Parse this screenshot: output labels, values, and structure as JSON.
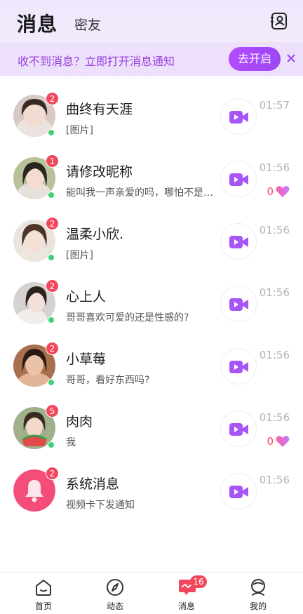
{
  "header": {
    "title": "消息",
    "subtitle": "密友"
  },
  "notice": {
    "text": "收不到消息？立即打开消息通知",
    "button": "去开启"
  },
  "conversations": [
    {
      "name": "曲终有天涯",
      "preview": "[图片]",
      "time": "01:57",
      "badge": "2",
      "online": true,
      "hearts": null
    },
    {
      "name": "请修改昵称",
      "preview": "能叫我一声亲爱的吗，哪怕不是…",
      "time": "01:56",
      "badge": "1",
      "online": true,
      "hearts": "0"
    },
    {
      "name": "温柔小欣.",
      "preview": "[图片]",
      "time": "01:56",
      "badge": "2",
      "online": true,
      "hearts": null
    },
    {
      "name": "心上人",
      "preview": "哥哥喜欢可爱的还是性感的?",
      "time": "01:56",
      "badge": "2",
      "online": true,
      "hearts": null
    },
    {
      "name": "小草莓",
      "preview": "哥哥，看好东西吗?",
      "time": "01:56",
      "badge": "2",
      "online": true,
      "hearts": null
    },
    {
      "name": "肉肉",
      "preview": "我",
      "time": "01:56",
      "badge": "5",
      "online": true,
      "hearts": "0"
    },
    {
      "name": "系统消息",
      "preview": "视频卡下发通知",
      "time": "01:56",
      "badge": "2",
      "online": false,
      "hearts": null
    }
  ],
  "tabs": [
    {
      "label": "首页",
      "icon": "home-icon"
    },
    {
      "label": "动态",
      "icon": "compass-icon"
    },
    {
      "label": "消息",
      "icon": "message-icon",
      "badge": "16"
    },
    {
      "label": "我的",
      "icon": "profile-icon"
    }
  ],
  "colors": {
    "accent": "#9b47f5",
    "badge": "#f2475d",
    "online": "#3fd07a",
    "system_avatar": "#f54d7a"
  }
}
